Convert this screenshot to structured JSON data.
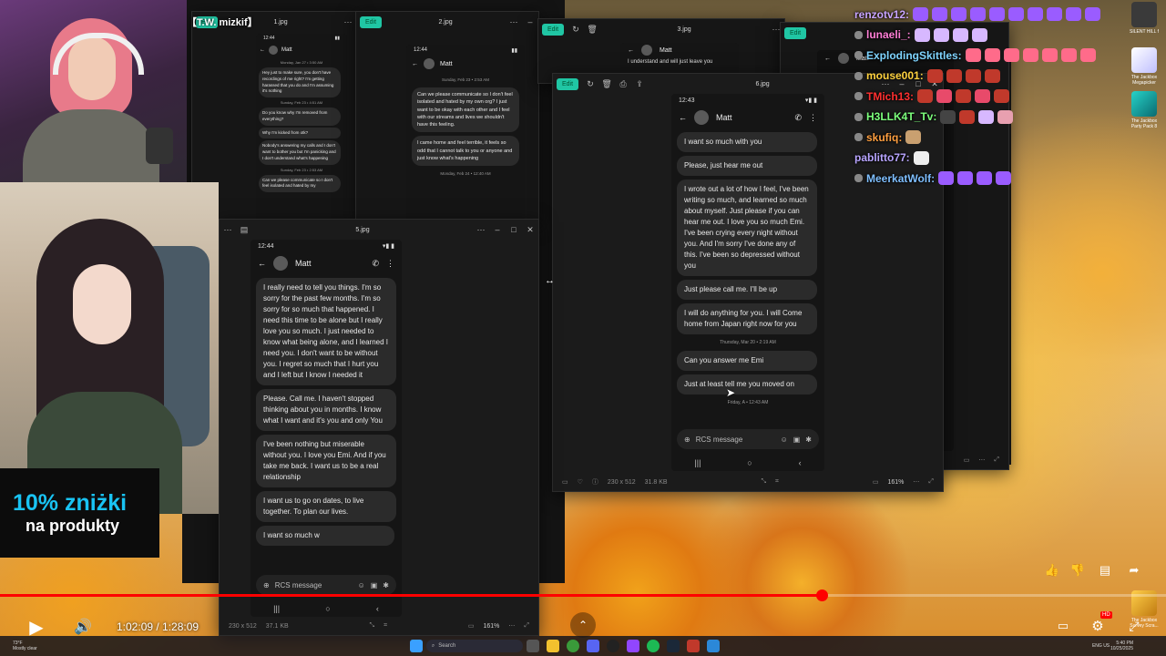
{
  "overlay_label": "【T.W. mizkif】",
  "promo": {
    "line1": "10% zniżki",
    "line2": "na produkty"
  },
  "windows": {
    "w1": {
      "title": "1.jpg",
      "edit": "Edit"
    },
    "w2": {
      "title": "2.jpg",
      "edit": "Edit"
    },
    "w3": {
      "title": "3.jpg",
      "edit": "Edit"
    },
    "w5": {
      "title": "5.jpg",
      "dims": "230 x 512",
      "size": "37.1 KB",
      "zoom": "161%"
    },
    "w6": {
      "title": "6.jpg",
      "edit": "Edit",
      "dims": "230 x 512",
      "size": "31.8 KB",
      "zoom": "161%"
    },
    "w4": {
      "edit": "Edit"
    }
  },
  "contact": "Matt",
  "phone1": {
    "time": "12:44",
    "dates": [
      "Monday, Jan 27 • 3:50 AM",
      "Sunday, Feb 23 • 4:51 AM",
      "Sunday, Feb 23 • 2:53 AM"
    ],
    "messages": [
      "Hey just to make sure, you don't have recordings of me right? I'm getting harassed that you do and I'm assuming it's nothing",
      "Do you know why I'm removed from everything?",
      "Why I'm kicked from otk?",
      "Nobody's answering my calls and I don't want to bother you but I'm panicking and I don't understand what's happening",
      "Can we please communicate so I don't feel isolated and hated by my"
    ]
  },
  "phone2": {
    "time": "12:44",
    "date_top": "Sunday, Feb 23 • 2:53 AM",
    "messages": [
      "Can we please communicate so I don't feel isolated and hated by my own org? I just want to be okay with each other and I feel with our streams and lives we shouldn't have this feeling.",
      "I came home and feel terrible, it feels so odd that I cannot talk to you or anyone and just know what's happening"
    ],
    "date_bottom": "Monday, Feb 24 • 12:40 AM"
  },
  "phone3": {
    "message": "I understand and will just leave you"
  },
  "phone5": {
    "time": "12:44",
    "messages": [
      "I really need to tell you things. I'm so sorry for the past few months. I'm so sorry for so much that happened. I need this time to be alone but I really love you so much. I just needed to know what being alone, and I learned I need you. I don't want to be without you. I regret so much that I hurt you and I left but I know I needed it",
      "Please. Call me. I haven't stopped thinking about you in months. I know what I want and it's you and only You",
      "I've been nothing but miserable without you. I love you Emi. And if you take me back. I want us to be a real relationship",
      "I want us to go on dates, to live together. To plan our lives.",
      "I want so much w"
    ],
    "composer": "RCS message"
  },
  "phone6": {
    "time": "12:43",
    "messages": [
      "I want so much with you",
      "Please, just hear me out",
      "I wrote out a lot of how I feel, I've been writing so much, and learned so much about myself. Just please if you can hear me out. I love you so much Emi. I've been crying every night without you. And I'm sorry I've done any of this. I've been so depressed without you",
      "Just please call me. I'll be up",
      "I will do anything for you. I will Come home from Japan right now for you"
    ],
    "date1": "Thursday, Mar 20 • 2:19 AM",
    "messages2": [
      "Can you answer me Emi",
      "Just at least tell me you moved on"
    ],
    "date2": "Friday, A     • 12:43 AM",
    "composer": "RCS message"
  },
  "chat": [
    {
      "user": "renzotv12:",
      "color": "#c9a5ff",
      "emotes": [
        "#9a5cff",
        "#9a5cff",
        "#9a5cff",
        "#9a5cff",
        "#9a5cff",
        "#9a5cff",
        "#9a5cff",
        "#9a5cff",
        "#9a5cff",
        "#9a5cff"
      ]
    },
    {
      "user": "lunaeli_:",
      "color": "#ff7fd6",
      "emotes": [
        "#d7b8ff",
        "#d7b8ff",
        "#d7b8ff",
        "#d7b8ff"
      ]
    },
    {
      "user": "ExplodingSkittles:",
      "color": "#7fd4ff",
      "emotes": [
        "#ff6b8a",
        "#ff6b8a",
        "#ff6b8a",
        "#ff6b8a",
        "#ff6b8a",
        "#ff6b8a",
        "#ff6b8a"
      ]
    },
    {
      "user": "mouse001:",
      "color": "#ffd23f",
      "emotes": [
        "#c0392b",
        "#c0392b",
        "#c0392b",
        "#c0392b"
      ]
    },
    {
      "user": "TMich13:",
      "color": "#ff3030",
      "emotes": [
        "#c0392b",
        "#e84a6a",
        "#c0392b",
        "#e84a6a",
        "#c0392b"
      ]
    },
    {
      "user": "H3LLK4T_Tv:",
      "color": "#7cff7c",
      "emotes": [
        "#444",
        "#c0392b",
        "#d7b8ff",
        "#e8a0b0"
      ]
    },
    {
      "user": "skufiq:",
      "color": "#ff9f40",
      "emotes": [
        "#c9a070"
      ]
    },
    {
      "user": "pablitto77:",
      "color": "#b8a5ff",
      "emotes": [
        "#eee"
      ]
    },
    {
      "user": "MeerkatWolf:",
      "color": "#7fbfff",
      "emotes": [
        "#9a5cff",
        "#9a5cff",
        "#9a5cff",
        "#9a5cff"
      ]
    }
  ],
  "desktop": {
    "silent_hill": "SILENT HILL f",
    "jackbox1": "The Jackbox Megapicker",
    "jackbox2": "The Jackbox Party Pack 8",
    "jackbox3": "The Jackbox Survey Scra..."
  },
  "player": {
    "time": "1:02:09 / 1:28:09",
    "progress": 0.705
  },
  "taskbar": {
    "weather": "73°F",
    "weather_sub": "Mostly clear",
    "search": "Search",
    "lang": "ENG US",
    "clock": "5:40 PM",
    "date": "10/25/2025"
  }
}
